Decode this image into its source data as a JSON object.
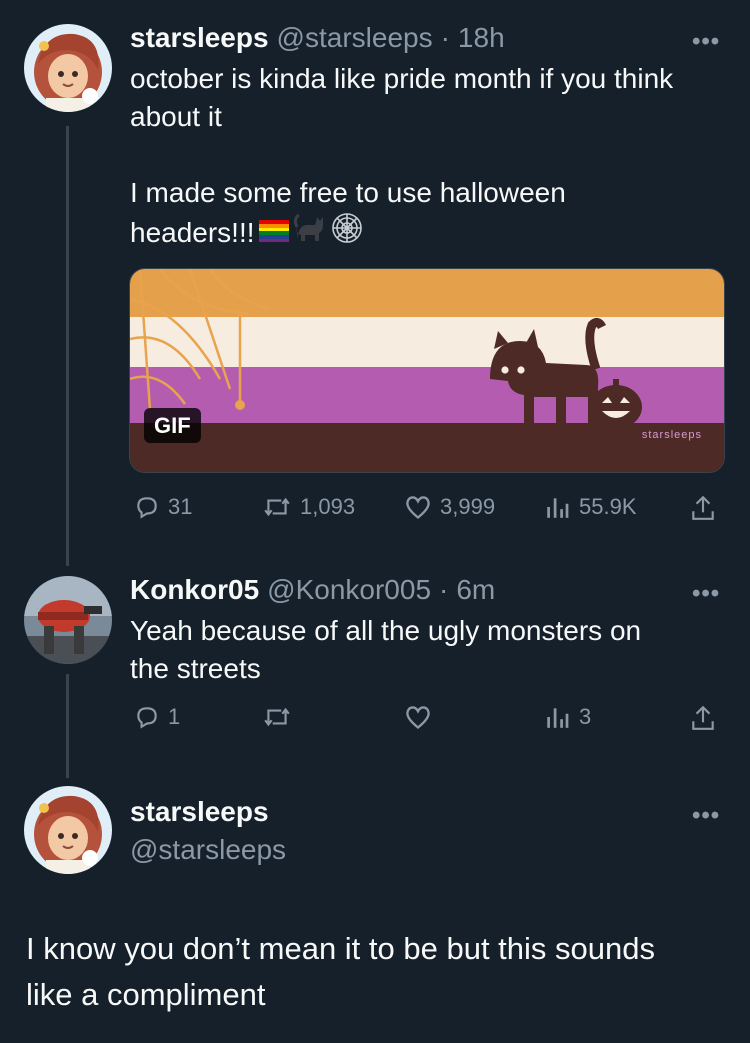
{
  "tweet1": {
    "name": "starsleeps",
    "handle": "@starsleeps",
    "time": "18h",
    "line1": "october is kinda like pride month if you think",
    "line2": "about it",
    "line3": "I made some free to use halloween",
    "line4": "headers!!!",
    "emojis": [
      "rainbow-flag-icon",
      "black-cat-icon",
      "spider-web-icon"
    ],
    "media_badge": "GIF",
    "media_watermark": "starsleeps",
    "stats": {
      "replies": "31",
      "retweets": "1,093",
      "likes": "3,999",
      "views": "55.9K"
    }
  },
  "tweet2": {
    "name": "Konkor05",
    "handle": "@Konkor005",
    "time": "6m",
    "line1": "Yeah because of all the ugly monsters on",
    "line2": "the streets",
    "stats": {
      "replies": "1",
      "views": "3"
    }
  },
  "tweet3": {
    "name": "starsleeps",
    "handle": "@starsleeps",
    "line1": "I know you don’t mean it to be but this sounds",
    "line2": "like a compliment"
  },
  "colors": {
    "background": "#15202b",
    "secondary_text": "#8b98a5",
    "flag_orange": "#e5a04c",
    "flag_cream": "#f7ece0",
    "flag_purple": "#b35cb0",
    "flag_brown": "#4e2a26"
  }
}
